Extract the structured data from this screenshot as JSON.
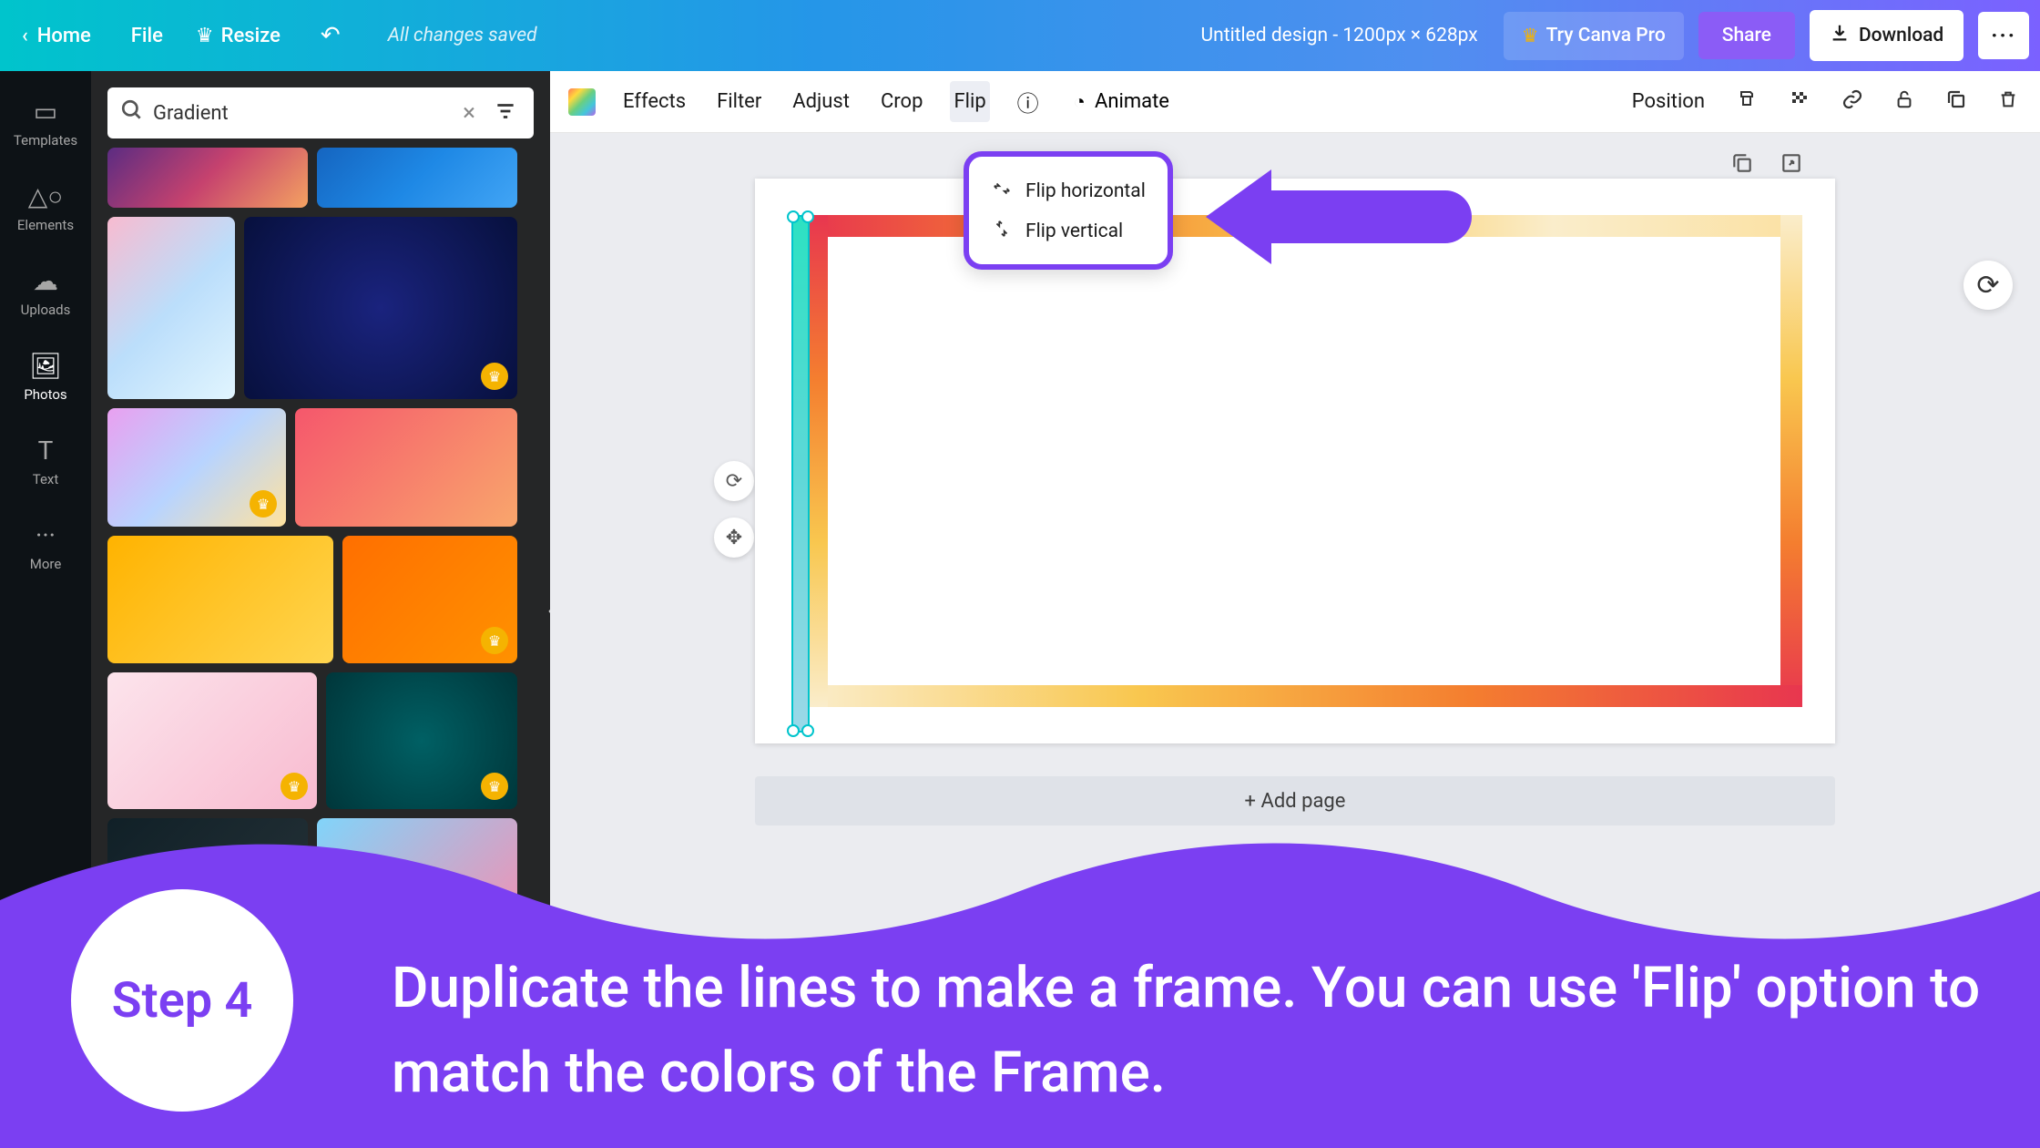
{
  "topbar": {
    "home": "Home",
    "file": "File",
    "resize": "Resize",
    "save_status": "All changes saved",
    "doc_title": "Untitled design - 1200px × 628px",
    "pro": "Try Canva Pro",
    "share": "Share",
    "download": "Download"
  },
  "rail": {
    "templates": "Templates",
    "elements": "Elements",
    "uploads": "Uploads",
    "photos": "Photos",
    "text": "Text",
    "more": "More"
  },
  "search": {
    "value": "Gradient"
  },
  "context": {
    "effects": "Effects",
    "filter": "Filter",
    "adjust": "Adjust",
    "crop": "Crop",
    "flip": "Flip",
    "animate": "Animate",
    "position": "Position"
  },
  "flip_menu": {
    "horizontal": "Flip horizontal",
    "vertical": "Flip vertical"
  },
  "add_page": "+ Add page",
  "tutorial": {
    "step": "Step 4",
    "text": "Duplicate the lines to make a frame. You can use 'Flip' option to match the colors of the Frame."
  }
}
